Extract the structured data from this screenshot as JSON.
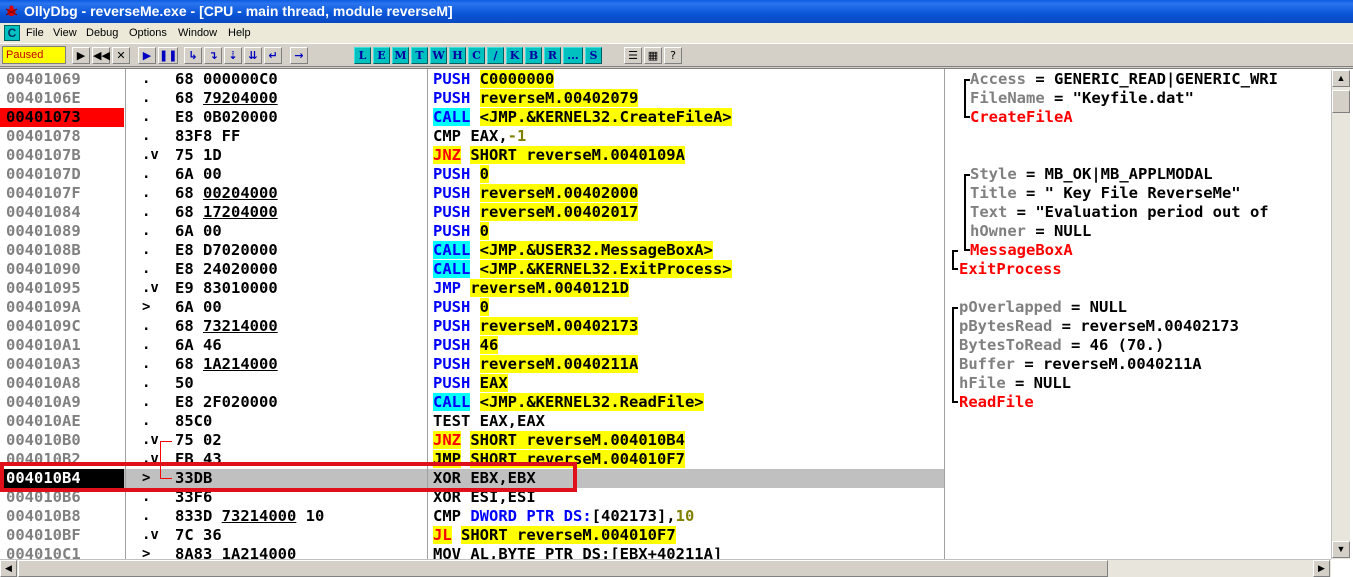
{
  "window": {
    "title": "OllyDbg - reverseMe.exe - [CPU - main thread, module reverseM]"
  },
  "menu": [
    "File",
    "View",
    "Debug",
    "Options",
    "Window",
    "Help"
  ],
  "status": "Paused",
  "toolbar": {
    "buttons": [
      {
        "glyph": "▶",
        "name": "open-icon"
      },
      {
        "glyph": "◀◀",
        "name": "restart-icon"
      },
      {
        "glyph": "✕",
        "name": "close-icon"
      },
      {
        "glyph": "▶",
        "name": "run-icon"
      },
      {
        "glyph": "❚❚",
        "name": "pause-icon"
      },
      {
        "glyph": "↳",
        "name": "step-into-icon"
      },
      {
        "glyph": "↴",
        "name": "step-over-icon"
      },
      {
        "glyph": "⇣",
        "name": "trace-into-icon"
      },
      {
        "glyph": "⇊",
        "name": "trace-over-icon"
      },
      {
        "glyph": "↵",
        "name": "execute-till-return-icon"
      },
      {
        "glyph": "→",
        "name": "go-to-icon"
      }
    ],
    "letters": [
      "L",
      "E",
      "M",
      "T",
      "W",
      "H",
      "C",
      "/",
      "K",
      "B",
      "R",
      "...",
      "S"
    ],
    "end_buttons": [
      {
        "glyph": "☰",
        "name": "list-icon"
      },
      {
        "glyph": "▦",
        "name": "colors-icon"
      },
      {
        "glyph": "?",
        "name": "help-icon"
      }
    ]
  },
  "disasm": [
    {
      "addr": "00401069",
      "mark": ".",
      "hex": "68 000000C0",
      "op": "PUSH",
      "opkind": "push",
      "args": [
        {
          "t": "C0000000",
          "c": "hl"
        }
      ]
    },
    {
      "addr": "0040106E",
      "mark": ".",
      "hex": "68 ",
      "hexu": "79204000",
      "op": "PUSH",
      "opkind": "push",
      "args": [
        {
          "t": "reverseM.00402079",
          "c": "hl"
        }
      ]
    },
    {
      "addr": "00401073",
      "mark": ".",
      "hex": "E8 0B020000",
      "op": "CALL",
      "opkind": "call",
      "addrkind": "bp",
      "args": [
        {
          "t": "<JMP.&KERNEL32.CreateFileA>",
          "c": "hl"
        }
      ]
    },
    {
      "addr": "00401078",
      "mark": ".",
      "hex": "83F8 FF",
      "op": "CMP",
      "opkind": "plain",
      "args": [
        {
          "t": " EAX,",
          "c": ""
        },
        {
          "t": "-1",
          "c": "num"
        }
      ]
    },
    {
      "addr": "0040107B",
      "mark": ".v",
      "hex": "75 1D",
      "op": "JNZ",
      "opkind": "jcc",
      "args": [
        {
          "t": "SHORT reverseM.0040109A",
          "c": "hl"
        }
      ]
    },
    {
      "addr": "0040107D",
      "mark": ".",
      "hex": "6A 00",
      "op": "PUSH",
      "opkind": "push",
      "args": [
        {
          "t": "0",
          "c": "hl"
        }
      ]
    },
    {
      "addr": "0040107F",
      "mark": ".",
      "hex": "68 ",
      "hexu": "00204000",
      "op": "PUSH",
      "opkind": "push",
      "args": [
        {
          "t": "reverseM.00402000",
          "c": "hl"
        }
      ]
    },
    {
      "addr": "00401084",
      "mark": ".",
      "hex": "68 ",
      "hexu": "17204000",
      "op": "PUSH",
      "opkind": "push",
      "args": [
        {
          "t": "reverseM.00402017",
          "c": "hl"
        }
      ]
    },
    {
      "addr": "00401089",
      "mark": ".",
      "hex": "6A 00",
      "op": "PUSH",
      "opkind": "push",
      "args": [
        {
          "t": "0",
          "c": "hl"
        }
      ]
    },
    {
      "addr": "0040108B",
      "mark": ".",
      "hex": "E8 D7020000",
      "op": "CALL",
      "opkind": "call",
      "args": [
        {
          "t": "<JMP.&USER32.MessageBoxA>",
          "c": "hl"
        }
      ]
    },
    {
      "addr": "00401090",
      "mark": ".",
      "hex": "E8 24020000",
      "op": "CALL",
      "opkind": "call",
      "args": [
        {
          "t": "<JMP.&KERNEL32.ExitProcess>",
          "c": "hl"
        }
      ]
    },
    {
      "addr": "00401095",
      "mark": ".v",
      "hex": "E9 83010000",
      "op": "JMP",
      "opkind": "push",
      "args": [
        {
          "t": "reverseM.0040121D",
          "c": "hl"
        }
      ]
    },
    {
      "addr": "0040109A",
      "mark": ">",
      "hex": "6A 00",
      "op": "PUSH",
      "opkind": "push",
      "args": [
        {
          "t": "0",
          "c": "hl"
        }
      ]
    },
    {
      "addr": "0040109C",
      "mark": ".",
      "hex": "68 ",
      "hexu": "73214000",
      "op": "PUSH",
      "opkind": "push",
      "args": [
        {
          "t": "reverseM.00402173",
          "c": "hl"
        }
      ]
    },
    {
      "addr": "004010A1",
      "mark": ".",
      "hex": "6A 46",
      "op": "PUSH",
      "opkind": "push",
      "args": [
        {
          "t": "46",
          "c": "hl"
        }
      ]
    },
    {
      "addr": "004010A3",
      "mark": ".",
      "hex": "68 ",
      "hexu": "1A214000",
      "op": "PUSH",
      "opkind": "push",
      "args": [
        {
          "t": "reverseM.0040211A",
          "c": "hl"
        }
      ]
    },
    {
      "addr": "004010A8",
      "mark": ".",
      "hex": "50",
      "op": "PUSH",
      "opkind": "push",
      "args": [
        {
          "t": "EAX",
          "c": "hl"
        }
      ]
    },
    {
      "addr": "004010A9",
      "mark": ".",
      "hex": "E8 2F020000",
      "op": "CALL",
      "opkind": "call",
      "args": [
        {
          "t": "<JMP.&KERNEL32.ReadFile>",
          "c": "hl"
        }
      ]
    },
    {
      "addr": "004010AE",
      "mark": ".",
      "hex": "85C0",
      "op": "TEST",
      "opkind": "plain",
      "args": [
        {
          "t": " EAX,EAX",
          "c": ""
        }
      ]
    },
    {
      "addr": "004010B0",
      "mark": ".v",
      "hex": "75 02",
      "op": "JNZ",
      "opkind": "jcc",
      "args": [
        {
          "t": "SHORT reverseM.004010B4",
          "c": "hl"
        }
      ]
    },
    {
      "addr": "004010B2",
      "mark": ".v",
      "hex": "EB 43",
      "op": "JMP",
      "opkind": "jmp",
      "args": [
        {
          "t": "SHORT reverseM.004010F7",
          "c": "hl"
        }
      ]
    },
    {
      "addr": "004010B4",
      "mark": ">",
      "hex": "33DB",
      "op": "XOR",
      "opkind": "plain",
      "addrkind": "eip",
      "current": true,
      "args": [
        {
          "t": " EBX,EBX",
          "c": ""
        }
      ]
    },
    {
      "addr": "004010B6",
      "mark": ".",
      "hex": "33F6",
      "op": "XOR",
      "opkind": "plain",
      "args": [
        {
          "t": " ESI,ESI",
          "c": ""
        }
      ]
    },
    {
      "addr": "004010B8",
      "mark": ".",
      "hex": "833D ",
      "hexu": "73214000",
      "hexafter": " 10",
      "op": "CMP",
      "opkind": "plain",
      "args": [
        {
          "t": " DWORD PTR DS:",
          "c": "ptr"
        },
        {
          "t": "[402173],",
          "c": ""
        },
        {
          "t": "10",
          "c": "num"
        }
      ]
    },
    {
      "addr": "004010BF",
      "mark": ".v",
      "hex": "7C 36",
      "op": "JL",
      "opkind": "jcc",
      "args": [
        {
          "t": "SHORT reverseM.004010F7",
          "c": "hl"
        }
      ]
    },
    {
      "addr": "004010C1",
      "mark": ">",
      "hex": "8A83 1A214000",
      "op": "MOV",
      "opkind": "plain",
      "args": [
        {
          "t": " AL,BYTE PTR DS:[EBX+40211A]",
          "c": ""
        }
      ]
    }
  ],
  "comments": [
    {
      "row": 0,
      "indent": 1,
      "k": "Access",
      "v": " = GENERIC_READ|GENERIC_WRI"
    },
    {
      "row": 1,
      "indent": 1,
      "k": "FileName",
      "v": " = \"Keyfile.dat\""
    },
    {
      "row": 2,
      "indent": 1,
      "fn": "CreateFileA"
    },
    {
      "row": 5,
      "indent": 1,
      "k": "Style",
      "v": " = MB_OK|MB_APPLMODAL"
    },
    {
      "row": 6,
      "indent": 1,
      "k": "Title",
      "v": " = \" Key File ReverseMe\""
    },
    {
      "row": 7,
      "indent": 1,
      "k": "Text",
      "v": " = \"Evaluation period out of"
    },
    {
      "row": 8,
      "indent": 1,
      "k": "hOwner",
      "v": " = NULL"
    },
    {
      "row": 9,
      "indent": 1,
      "fn": "MessageBoxA"
    },
    {
      "row": 10,
      "indent": 0,
      "fn": "ExitProcess"
    },
    {
      "row": 12,
      "indent": 0,
      "k": "pOverlapped",
      "v": " = NULL"
    },
    {
      "row": 13,
      "indent": 0,
      "k": "pBytesRead",
      "v": " = reverseM.00402173"
    },
    {
      "row": 14,
      "indent": 0,
      "k": "BytesToRead",
      "v": " = 46 (70.)"
    },
    {
      "row": 15,
      "indent": 0,
      "k": "Buffer",
      "v": " = reverseM.0040211A"
    },
    {
      "row": 16,
      "indent": 0,
      "k": "hFile",
      "v": " = NULL"
    },
    {
      "row": 17,
      "indent": 0,
      "fn": "ReadFile"
    }
  ],
  "colors": {
    "breakpoint": "#ff0000",
    "highlight_box": "#e0101a",
    "call_bg": "#00ffff",
    "jump_bg": "#ffff00"
  }
}
